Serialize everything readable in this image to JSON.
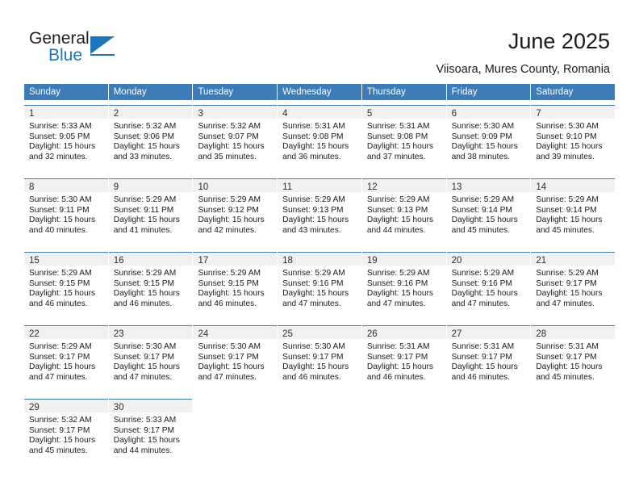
{
  "logo": {
    "word_top": "General",
    "word_bottom": "Blue",
    "triangle_color": "#1b76bc",
    "icon": "general-blue-logo"
  },
  "header": {
    "title": "June 2025",
    "subtitle": "Viisoara, Mures County, Romania"
  },
  "calendar": {
    "header_color": "#3c7cb8",
    "daynum_band_color": "#f1f1f1",
    "weekdays": [
      "Sunday",
      "Monday",
      "Tuesday",
      "Wednesday",
      "Thursday",
      "Friday",
      "Saturday"
    ],
    "weeks": [
      [
        {
          "day": "1",
          "sunrise": "Sunrise: 5:33 AM",
          "sunset": "Sunset: 9:05 PM",
          "daylight": "Daylight: 15 hours and 32 minutes."
        },
        {
          "day": "2",
          "sunrise": "Sunrise: 5:32 AM",
          "sunset": "Sunset: 9:06 PM",
          "daylight": "Daylight: 15 hours and 33 minutes."
        },
        {
          "day": "3",
          "sunrise": "Sunrise: 5:32 AM",
          "sunset": "Sunset: 9:07 PM",
          "daylight": "Daylight: 15 hours and 35 minutes."
        },
        {
          "day": "4",
          "sunrise": "Sunrise: 5:31 AM",
          "sunset": "Sunset: 9:08 PM",
          "daylight": "Daylight: 15 hours and 36 minutes."
        },
        {
          "day": "5",
          "sunrise": "Sunrise: 5:31 AM",
          "sunset": "Sunset: 9:08 PM",
          "daylight": "Daylight: 15 hours and 37 minutes."
        },
        {
          "day": "6",
          "sunrise": "Sunrise: 5:30 AM",
          "sunset": "Sunset: 9:09 PM",
          "daylight": "Daylight: 15 hours and 38 minutes."
        },
        {
          "day": "7",
          "sunrise": "Sunrise: 5:30 AM",
          "sunset": "Sunset: 9:10 PM",
          "daylight": "Daylight: 15 hours and 39 minutes."
        }
      ],
      [
        {
          "day": "8",
          "sunrise": "Sunrise: 5:30 AM",
          "sunset": "Sunset: 9:11 PM",
          "daylight": "Daylight: 15 hours and 40 minutes."
        },
        {
          "day": "9",
          "sunrise": "Sunrise: 5:29 AM",
          "sunset": "Sunset: 9:11 PM",
          "daylight": "Daylight: 15 hours and 41 minutes."
        },
        {
          "day": "10",
          "sunrise": "Sunrise: 5:29 AM",
          "sunset": "Sunset: 9:12 PM",
          "daylight": "Daylight: 15 hours and 42 minutes."
        },
        {
          "day": "11",
          "sunrise": "Sunrise: 5:29 AM",
          "sunset": "Sunset: 9:13 PM",
          "daylight": "Daylight: 15 hours and 43 minutes."
        },
        {
          "day": "12",
          "sunrise": "Sunrise: 5:29 AM",
          "sunset": "Sunset: 9:13 PM",
          "daylight": "Daylight: 15 hours and 44 minutes."
        },
        {
          "day": "13",
          "sunrise": "Sunrise: 5:29 AM",
          "sunset": "Sunset: 9:14 PM",
          "daylight": "Daylight: 15 hours and 45 minutes."
        },
        {
          "day": "14",
          "sunrise": "Sunrise: 5:29 AM",
          "sunset": "Sunset: 9:14 PM",
          "daylight": "Daylight: 15 hours and 45 minutes."
        }
      ],
      [
        {
          "day": "15",
          "sunrise": "Sunrise: 5:29 AM",
          "sunset": "Sunset: 9:15 PM",
          "daylight": "Daylight: 15 hours and 46 minutes."
        },
        {
          "day": "16",
          "sunrise": "Sunrise: 5:29 AM",
          "sunset": "Sunset: 9:15 PM",
          "daylight": "Daylight: 15 hours and 46 minutes."
        },
        {
          "day": "17",
          "sunrise": "Sunrise: 5:29 AM",
          "sunset": "Sunset: 9:15 PM",
          "daylight": "Daylight: 15 hours and 46 minutes."
        },
        {
          "day": "18",
          "sunrise": "Sunrise: 5:29 AM",
          "sunset": "Sunset: 9:16 PM",
          "daylight": "Daylight: 15 hours and 47 minutes."
        },
        {
          "day": "19",
          "sunrise": "Sunrise: 5:29 AM",
          "sunset": "Sunset: 9:16 PM",
          "daylight": "Daylight: 15 hours and 47 minutes."
        },
        {
          "day": "20",
          "sunrise": "Sunrise: 5:29 AM",
          "sunset": "Sunset: 9:16 PM",
          "daylight": "Daylight: 15 hours and 47 minutes."
        },
        {
          "day": "21",
          "sunrise": "Sunrise: 5:29 AM",
          "sunset": "Sunset: 9:17 PM",
          "daylight": "Daylight: 15 hours and 47 minutes."
        }
      ],
      [
        {
          "day": "22",
          "sunrise": "Sunrise: 5:29 AM",
          "sunset": "Sunset: 9:17 PM",
          "daylight": "Daylight: 15 hours and 47 minutes."
        },
        {
          "day": "23",
          "sunrise": "Sunrise: 5:30 AM",
          "sunset": "Sunset: 9:17 PM",
          "daylight": "Daylight: 15 hours and 47 minutes."
        },
        {
          "day": "24",
          "sunrise": "Sunrise: 5:30 AM",
          "sunset": "Sunset: 9:17 PM",
          "daylight": "Daylight: 15 hours and 47 minutes."
        },
        {
          "day": "25",
          "sunrise": "Sunrise: 5:30 AM",
          "sunset": "Sunset: 9:17 PM",
          "daylight": "Daylight: 15 hours and 46 minutes."
        },
        {
          "day": "26",
          "sunrise": "Sunrise: 5:31 AM",
          "sunset": "Sunset: 9:17 PM",
          "daylight": "Daylight: 15 hours and 46 minutes."
        },
        {
          "day": "27",
          "sunrise": "Sunrise: 5:31 AM",
          "sunset": "Sunset: 9:17 PM",
          "daylight": "Daylight: 15 hours and 46 minutes."
        },
        {
          "day": "28",
          "sunrise": "Sunrise: 5:31 AM",
          "sunset": "Sunset: 9:17 PM",
          "daylight": "Daylight: 15 hours and 45 minutes."
        }
      ],
      [
        {
          "day": "29",
          "sunrise": "Sunrise: 5:32 AM",
          "sunset": "Sunset: 9:17 PM",
          "daylight": "Daylight: 15 hours and 45 minutes."
        },
        {
          "day": "30",
          "sunrise": "Sunrise: 5:33 AM",
          "sunset": "Sunset: 9:17 PM",
          "daylight": "Daylight: 15 hours and 44 minutes."
        },
        {
          "day": "",
          "sunrise": "",
          "sunset": "",
          "daylight": ""
        },
        {
          "day": "",
          "sunrise": "",
          "sunset": "",
          "daylight": ""
        },
        {
          "day": "",
          "sunrise": "",
          "sunset": "",
          "daylight": ""
        },
        {
          "day": "",
          "sunrise": "",
          "sunset": "",
          "daylight": ""
        },
        {
          "day": "",
          "sunrise": "",
          "sunset": "",
          "daylight": ""
        }
      ]
    ]
  }
}
